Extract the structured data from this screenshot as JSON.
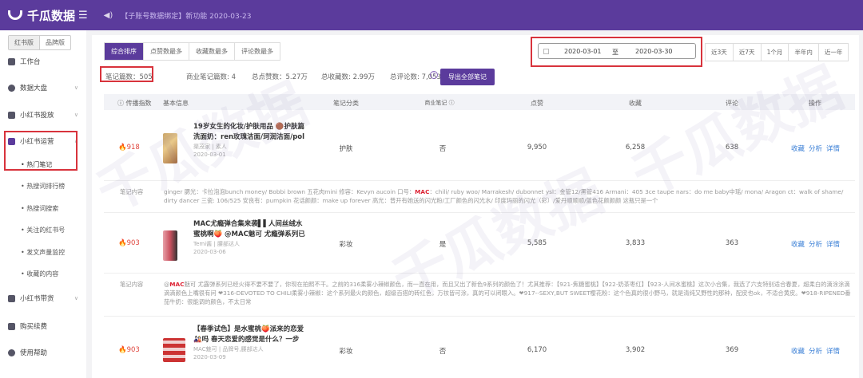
{
  "header": {
    "logo": "千瓜数据",
    "notice": "【子账号数据绑定】新功能 2020-03-23"
  },
  "sidebar": {
    "toggle": [
      "红书版",
      "品牌版"
    ],
    "items": [
      {
        "label": "工作台"
      },
      {
        "label": "数据大盘"
      },
      {
        "label": "小红书投放"
      },
      {
        "label": "小红书运营"
      },
      {
        "label": "小红书带货"
      },
      {
        "label": "购买续费"
      },
      {
        "label": "使用帮助"
      }
    ],
    "subitems": [
      "热门笔记",
      "热搜词排行榜",
      "热搜词搜索",
      "关注的红书号",
      "发文声量监控",
      "收藏的内容"
    ]
  },
  "tabs": [
    "综合排序",
    "点赞数最多",
    "收藏数最多",
    "评论数最多"
  ],
  "stats": {
    "notes": "笔记篇数：505",
    "biz": "商业笔记篇数: 4",
    "likes": "总点赞数：5.27万",
    "favs": "总收藏数: 2.99万",
    "comments": "总评论数: 7,053",
    "export": "导出全部笔记"
  },
  "date": {
    "start": "2020-03-01",
    "sep": "至",
    "end": "2020-03-30"
  },
  "quick": [
    "近3天",
    "近7天",
    "1个月",
    "半年内",
    "近一年"
  ],
  "table": {
    "headers": [
      "传播指数",
      "基本信息",
      "笔记分类",
      "商业笔记",
      "点赞",
      "收藏",
      "评论",
      "操作"
    ],
    "actions": [
      "收藏",
      "分析",
      "详情"
    ],
    "content_label": "笔记内容",
    "rows": [
      {
        "index": "918",
        "title": "19岁女生的化妆/护肤用品 🟤护肤篇 洗面奶：ren玫瑰洁面/珂润洁面/pol",
        "author": "渠茂家 | 素人",
        "date": "2020-03-01",
        "category": "护肤",
        "biz": "否",
        "likes": "9,950",
        "favs": "6,258",
        "comments": "638",
        "content_pre": "ginger 腮光：卡拉泡泡bunch money/ Bobbi brown 五花肉mini 修容：Kevyn aucoin 口号：",
        "content_mac": "MAC",
        "content_post": "：chili/ ruby woo/ Marrakesh/ dubonnet ysl：金管12/黑管416 Armani：405 3ce taupe nars：do me baby中瑶/ mona/ Aragon ct：walk of shame/ dirty dancer 三瓷: 106/525 安良有：pumpkin 花话颜颜：make up forever 高光：普开有她送的闪光粉/工厂颜色的闪光水/ 印度玛丽的闪光（彩）/爱丹顺顺顺/蓝色花颜颜颜 这瓶只是一个"
      },
      {
        "index": "903",
        "title": "MAC尤瘾弹合集来袭▌▌人间丝绒水蜜桃啊🍑 @MAC魅可 尤瘾弹系列已",
        "author": "Temi酱 | 腰部达人",
        "date": "2020-03-06",
        "category": "彩妆",
        "biz": "是",
        "likes": "5,585",
        "favs": "3,833",
        "comments": "363",
        "content_pre": "@",
        "content_mac": "MAC",
        "content_post": "魅可 尤露弹系列已经火得不要不要了，你现在拍照不干。之前的316柔雾小辣椒颜色，而一直在用，而且又出了新色9系列的颜色了！尤其推荐：【921-焦糖蜜桃】【922-奶茶枣红】【923-人间水蜜桃】这次小合集，我选了六支特别适合春夏，超柔白的滴涂涂滴滴滴颜色上嘴很有问 ❤316-DEVOTED TO CHILI柔雾小辣椒：这个系列最火的颜色，超级百搭的砖红色，万妆皆可涂，真的可以闭眼入。❤917--SEXY,BUT SWEET樱花粉：这个色真的很小野马，就是清纯又野性的那种，配皮也ok，不适合黄皮。❤918-RIPENED番茄牛奶：很能调的颜色，不太日常"
      },
      {
        "index": "903",
        "title": "【春季试色】是水蜜桃🍑派来的恋爱🎎吗 春天恋爱的感觉是什么？一步",
        "author": "MAC魅可 | 品牌号,腰部达人",
        "date": "2020-03-09",
        "category": "彩妆",
        "biz": "否",
        "likes": "6,170",
        "favs": "3,902",
        "comments": "369"
      }
    ]
  },
  "watermark": "千瓜数据",
  "colors": {
    "brand": "#5b3b9c",
    "highlight": "#d8333c",
    "link": "#3a7fd6"
  }
}
